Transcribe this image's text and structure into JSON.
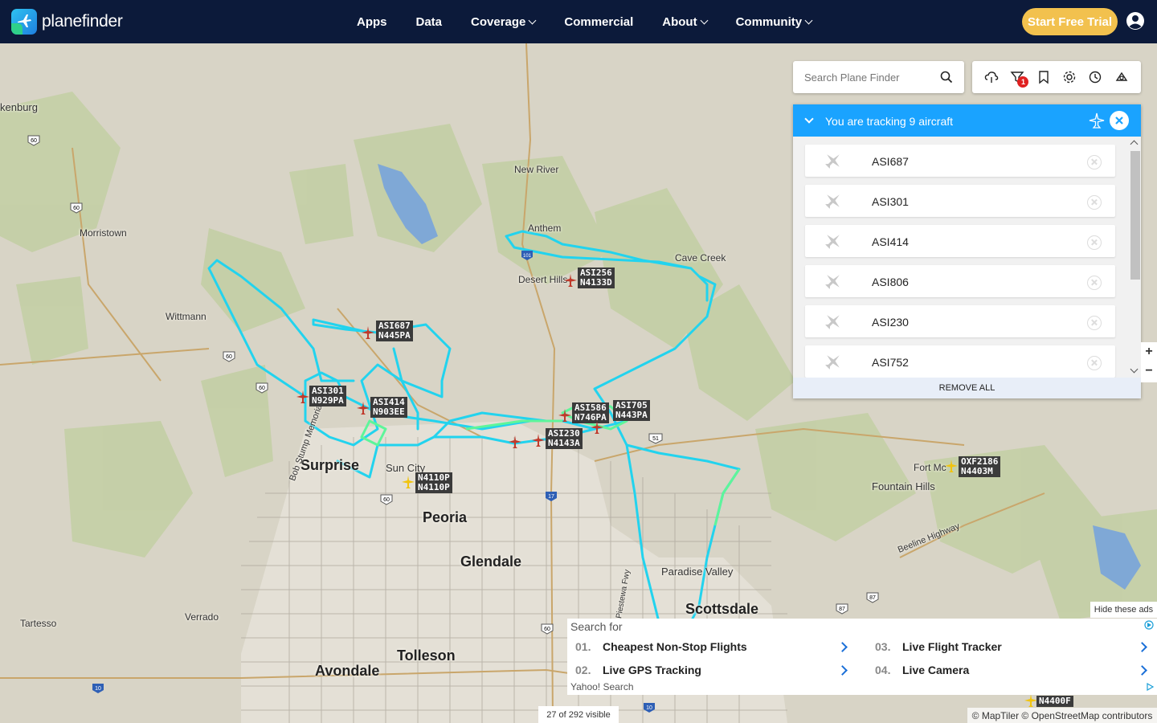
{
  "brand": {
    "name": "planefinder"
  },
  "nav": {
    "items": [
      {
        "label": "Apps",
        "dropdown": false
      },
      {
        "label": "Data",
        "dropdown": false
      },
      {
        "label": "Coverage",
        "dropdown": true
      },
      {
        "label": "Commercial",
        "dropdown": false
      },
      {
        "label": "About",
        "dropdown": true
      },
      {
        "label": "Community",
        "dropdown": true
      }
    ],
    "trial_label": "Start Free Trial"
  },
  "search": {
    "placeholder": "Search Plane Finder"
  },
  "toolbar": {
    "icons": [
      "cloud-icon",
      "filter-icon",
      "bookmark-icon",
      "settings-icon",
      "history-icon",
      "3d-view-icon"
    ],
    "filter_badge": "1"
  },
  "tracking": {
    "title": "You are tracking 9 aircraft",
    "aircraft": [
      "ASI687",
      "ASI301",
      "ASI414",
      "ASI806",
      "ASI230",
      "ASI752"
    ],
    "remove_all_label": "REMOVE ALL"
  },
  "map": {
    "cities_major": [
      {
        "name": "Surprise"
      },
      {
        "name": "Peoria"
      },
      {
        "name": "Glendale"
      },
      {
        "name": "Scottsdale"
      },
      {
        "name": "Tolleson"
      },
      {
        "name": "Avondale"
      }
    ],
    "cities_minor": [
      "kenburg",
      "New River",
      "Anthem",
      "Morristown",
      "Cave Creek",
      "Desert Hills",
      "Wittmann",
      "Sun City",
      "Fort Mc",
      "Fountain Hills",
      "Paradise Valley",
      "Verrado",
      "Tartesso",
      "Beeline Highway",
      "Bob Stump Memorial",
      "Piestewa Fwy"
    ],
    "aircraft_tags": [
      {
        "lines": [
          "ASI687",
          "N445PA"
        ]
      },
      {
        "lines": [
          "ASI256",
          "N4133D"
        ]
      },
      {
        "lines": [
          "ASI301",
          "N929PA"
        ]
      },
      {
        "lines": [
          "ASI414",
          "N903EE"
        ]
      },
      {
        "lines": [
          "ASI586",
          "N746PA"
        ]
      },
      {
        "lines": [
          "ASI705",
          "N443PA"
        ]
      },
      {
        "lines": [
          "ASI230",
          "N4143A"
        ]
      },
      {
        "lines": [
          "N4110P",
          "N4110P"
        ]
      },
      {
        "lines": [
          "OXF2186",
          "N4403M"
        ]
      },
      {
        "lines": [
          "N4400F"
        ]
      }
    ],
    "highway_shields": [
      "60",
      "60",
      "60",
      "60",
      "17",
      "10",
      "10",
      "51",
      "87",
      "87",
      "60",
      "60",
      "101"
    ]
  },
  "ad": {
    "hide_label": "Hide these ads",
    "search_for": "Search for",
    "links": [
      {
        "num": "01.",
        "text": "Cheapest Non-Stop Flights"
      },
      {
        "num": "03.",
        "text": "Live Flight Tracker"
      },
      {
        "num": "02.",
        "text": "Live GPS Tracking"
      },
      {
        "num": "04.",
        "text": "Live Camera"
      }
    ],
    "provider": "Yahoo! Search"
  },
  "status": {
    "visible_count": "27 of 292 visible",
    "attribution": "© MapTiler © OpenStreetMap contributors"
  },
  "colors": {
    "navbar": "#0c1a3a",
    "trial": "#f2c14e",
    "panel_header": "#1aa3ff",
    "track_primary": "#22d3ee",
    "track_secondary": "#5ef59a",
    "plane_tracked": "#c0392b",
    "plane_other": "#f1c40f"
  }
}
